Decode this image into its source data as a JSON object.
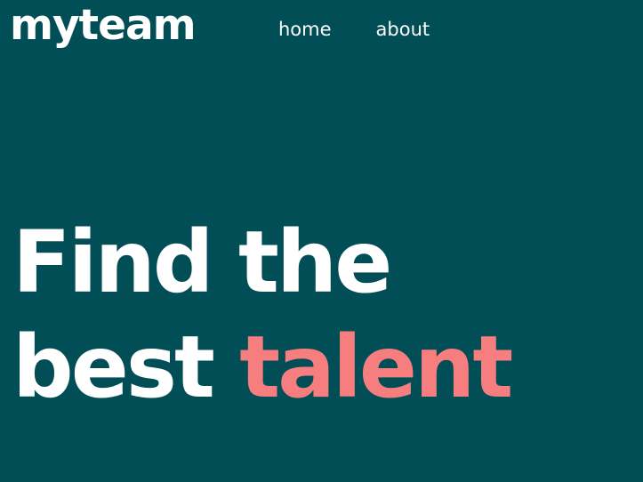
{
  "header": {
    "logo": "myteam",
    "nav": [
      {
        "label": "home"
      },
      {
        "label": "about"
      }
    ]
  },
  "hero": {
    "line1": "Find the",
    "line2_start": "best",
    "line2_accent": "talent"
  },
  "colors": {
    "background": "#014e56",
    "text": "#ffffff",
    "accent": "#f67e7e"
  }
}
